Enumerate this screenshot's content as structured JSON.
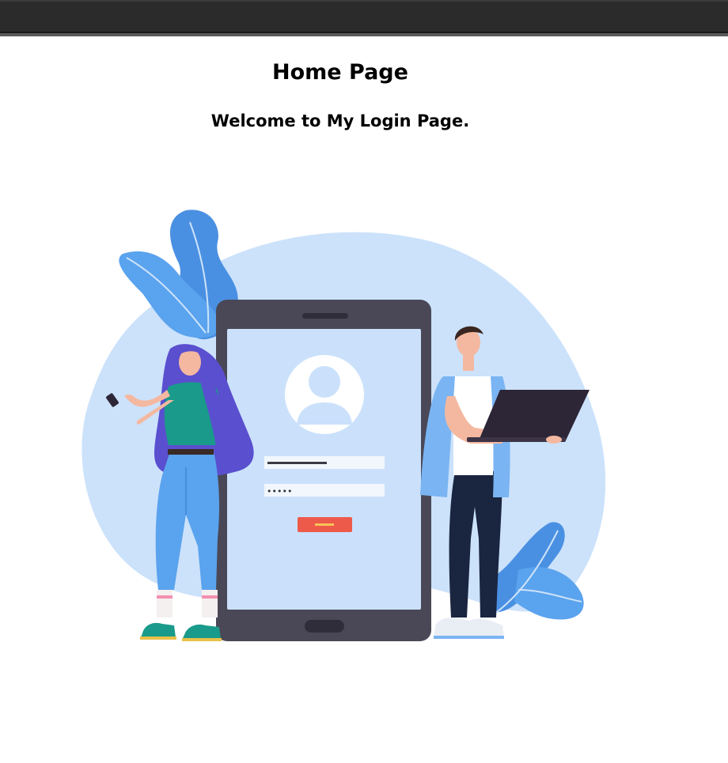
{
  "page": {
    "title": "Home Page",
    "welcome": "Welcome to My Login Page."
  },
  "illustration": {
    "subject": "login-illustration",
    "password_mask": "•••••",
    "colors": {
      "blob": "#cce2fb",
      "leaf": "#4a90e2",
      "phone_frame": "#4a4857",
      "phone_screen": "#cbe1fb",
      "login_button": "#ee5a4a",
      "laptop": "#2d2637",
      "woman_shirt": "#1a9a8a",
      "man_jacket": "#7ab4f2",
      "jeans": "#5aa3ee",
      "man_pants": "#1a2540"
    }
  }
}
